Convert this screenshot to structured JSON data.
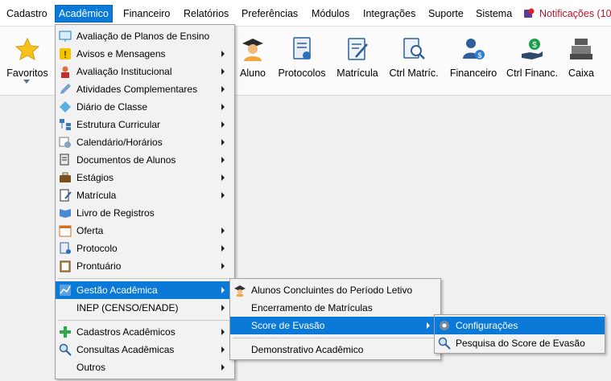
{
  "menubar": {
    "items": [
      "Cadastro",
      "Acadêmico",
      "Financeiro",
      "Relatórios",
      "Preferências",
      "Módulos",
      "Integrações",
      "Suporte",
      "Sistema"
    ],
    "active": "Acadêmico",
    "notifications": "Notificações (10"
  },
  "toolbar": {
    "buttons": [
      {
        "label": "Favoritos",
        "icon": "star-icon"
      },
      {
        "label": "Aluno",
        "icon": "student-icon"
      },
      {
        "label": "Protocolos",
        "icon": "protocol-icon"
      },
      {
        "label": "Matrícula",
        "icon": "enrollment-icon"
      },
      {
        "label": "Ctrl Matríc.",
        "icon": "enrollment-search-icon"
      },
      {
        "label": "Financeiro",
        "icon": "finance-user-icon"
      },
      {
        "label": "Ctrl Financ.",
        "icon": "money-hand-icon"
      },
      {
        "label": "Caixa",
        "icon": "cash-register-icon"
      }
    ]
  },
  "academico_menu": {
    "items": [
      {
        "label": "Avaliação de Planos de Ensino",
        "submenu": false
      },
      {
        "label": "Avisos e Mensagens",
        "submenu": true
      },
      {
        "label": "Avaliação Institucional",
        "submenu": true
      },
      {
        "label": "Atividades Complementares",
        "submenu": true
      },
      {
        "label": "Diário de Classe",
        "submenu": true
      },
      {
        "label": "Estrutura Curricular",
        "submenu": true
      },
      {
        "label": "Calendário/Horários",
        "submenu": true
      },
      {
        "label": "Documentos de Alunos",
        "submenu": true
      },
      {
        "label": "Estágios",
        "submenu": true
      },
      {
        "label": "Matrícula",
        "submenu": true
      },
      {
        "label": "Livro de Registros",
        "submenu": false
      },
      {
        "label": "Oferta",
        "submenu": true
      },
      {
        "label": "Protocolo",
        "submenu": true
      },
      {
        "label": "Prontuário",
        "submenu": true
      },
      {
        "label": "Gestão Acadêmica",
        "submenu": true
      },
      {
        "label": "INEP (CENSO/ENADE)",
        "submenu": true
      },
      {
        "label": "Cadastros Acadêmicos",
        "submenu": true
      },
      {
        "label": "Consultas Acadêmicas",
        "submenu": true
      },
      {
        "label": "Outros",
        "submenu": true
      }
    ]
  },
  "gestao_menu": {
    "items": [
      {
        "label": "Alunos Concluintes do Período Letivo"
      },
      {
        "label": "Encerramento de Matrículas"
      },
      {
        "label": "Score de Evasão"
      },
      {
        "label": "Demonstrativo Acadêmico"
      }
    ]
  },
  "score_menu": {
    "items": [
      {
        "label": "Configurações"
      },
      {
        "label": "Pesquisa do Score de Evasão"
      }
    ]
  },
  "colors": {
    "highlight": "#0a79d8",
    "notification": "#c0102a"
  }
}
